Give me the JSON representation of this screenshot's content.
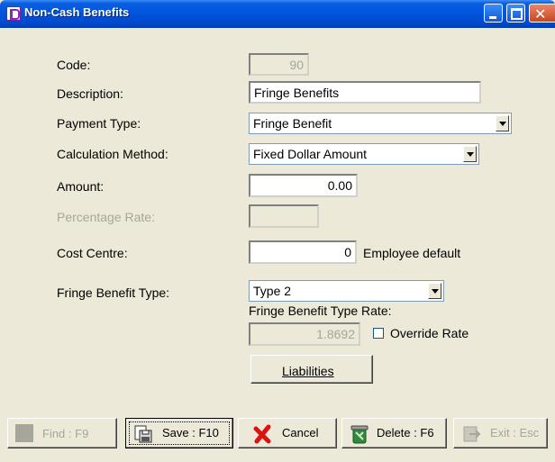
{
  "window": {
    "title": "Non-Cash Benefits"
  },
  "form": {
    "code": {
      "label": "Code:",
      "value": "90"
    },
    "description": {
      "label": "Description:",
      "value": "Fringe Benefits"
    },
    "payment_type": {
      "label": "Payment Type:",
      "value": "Fringe Benefit"
    },
    "calculation_method": {
      "label": "Calculation Method:",
      "value": "Fixed Dollar Amount"
    },
    "amount": {
      "label": "Amount:",
      "value": "0.00"
    },
    "percentage_rate": {
      "label": "Percentage Rate:",
      "value": ""
    },
    "cost_centre": {
      "label": "Cost Centre:",
      "value": "0",
      "note": "Employee default"
    },
    "fringe_benefit_type": {
      "label": "Fringe Benefit Type:",
      "value": "Type 2"
    },
    "fringe_benefit_type_rate": {
      "label": "Fringe Benefit Type Rate:",
      "value": "1.8692"
    },
    "override_rate": {
      "label": "Override Rate",
      "checked": false
    },
    "liabilities_button": {
      "label": "Liabilities"
    }
  },
  "toolbar": {
    "find": "Find : F9",
    "save": "Save : F10",
    "cancel": "Cancel",
    "delete": "Delete : F6",
    "exit": "Exit : Esc"
  },
  "icons": {
    "app": "app-icon",
    "minimize": "minimize-icon",
    "maximize": "maximize-icon",
    "close": "close-icon",
    "find": "find-icon",
    "save": "save-icon",
    "cancel": "cancel-icon",
    "delete": "delete-icon",
    "exit": "exit-icon"
  }
}
